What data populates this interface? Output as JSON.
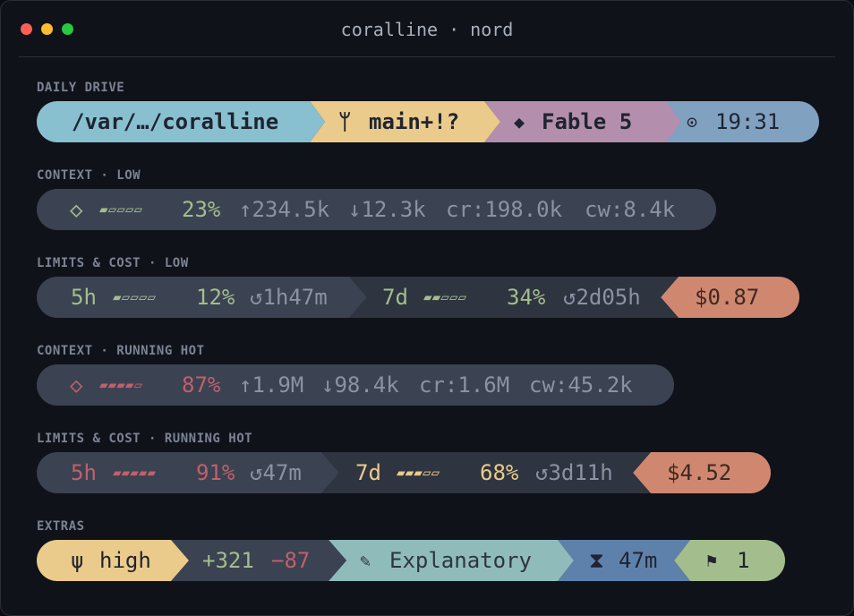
{
  "window": {
    "title": "coralline · nord",
    "traffic_lights": [
      "#ff5f57",
      "#febc2e",
      "#28c840"
    ]
  },
  "colors": {
    "cyan": "#88c0d0",
    "yellow": "#ebcb8b",
    "purple": "#b48ead",
    "blue": "#81a1c1",
    "slate": "#3b4252",
    "dark": "#2e3440",
    "orange": "#d08770",
    "green": "#a3be8c",
    "red": "#bf616a",
    "teal": "#8fbcbb",
    "steel": "#5e81ac"
  },
  "daily_drive": {
    "label": "DAILY DRIVE",
    "path": "/var/…/coralline",
    "branch_icon": "git-branch-icon",
    "branch_glyph": "ᛘ",
    "branch": "main+!?",
    "model_icon": "diamond-icon",
    "model_glyph": "◆",
    "model": "Fable 5",
    "clock_icon": "clock-icon",
    "clock_glyph": "⊙",
    "time": "19:31"
  },
  "context_low": {
    "label": "CONTEXT · LOW",
    "icon_glyph": "◇",
    "meter": "▰▱▱▱▱",
    "pct": "23%",
    "up": "↑234.5k",
    "down": "↓12.3k",
    "cr": "cr:198.0k",
    "cw": "cw:8.4k"
  },
  "limits_low": {
    "label": "LIMITS & COST · LOW",
    "a_window": "5h",
    "a_meter": "▰▱▱▱▱",
    "a_pct": "12%",
    "a_reset": "↺1h47m",
    "b_window": "7d",
    "b_meter": "▰▰▱▱▱",
    "b_pct": "34%",
    "b_reset": "↺2d05h",
    "cost": "$0.87"
  },
  "context_hot": {
    "label": "CONTEXT · RUNNING HOT",
    "icon_glyph": "◇",
    "meter": "▰▰▰▰▱",
    "pct": "87%",
    "up": "↑1.9M",
    "down": "↓98.4k",
    "cr": "cr:1.6M",
    "cw": "cw:45.2k"
  },
  "limits_hot": {
    "label": "LIMITS & COST · RUNNING HOT",
    "a_window": "5h",
    "a_meter": "▰▰▰▰▰",
    "a_pct": "91%",
    "a_reset": "↺47m",
    "b_window": "7d",
    "b_meter": "▰▰▰▱▱",
    "b_pct": "68%",
    "b_reset": "↺3d11h",
    "cost": "$4.52"
  },
  "extras": {
    "label": "EXTRAS",
    "effort_glyph": "ψ",
    "effort": "high",
    "added": "+321",
    "removed": "−87",
    "style_glyph": "✎",
    "style": "Explanatory",
    "timer_glyph": "⧗",
    "timer": "47m",
    "flag_glyph": "⚑",
    "flags": "1"
  }
}
